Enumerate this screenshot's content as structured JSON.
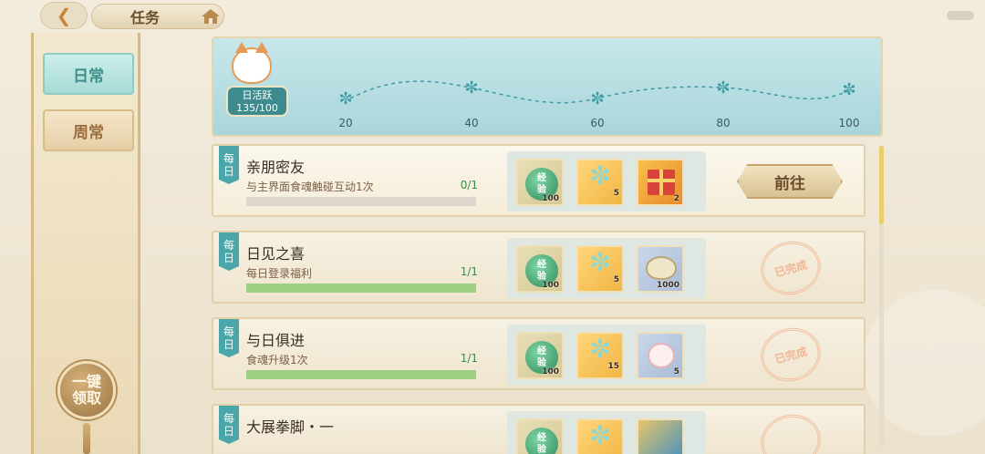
{
  "header": {
    "title": "任务",
    "back_icon": "back-arrow-icon",
    "home_icon": "house-icon"
  },
  "sidebar": {
    "tabs": [
      {
        "label": "日常",
        "active": true
      },
      {
        "label": "周常",
        "active": false
      }
    ],
    "claim_all": {
      "line1": "一键",
      "line2": "领取"
    }
  },
  "activity": {
    "label": "日活跃",
    "progress": "135/100",
    "milestones": [
      "20",
      "40",
      "60",
      "80",
      "100"
    ],
    "colors": {
      "accent": "#3d8b8e"
    }
  },
  "tasks": [
    {
      "tag": [
        "每",
        "日"
      ],
      "name": "亲朋密友",
      "desc": "与主界面食魂触碰互动1次",
      "progress_text": "0/1",
      "progress_fraction": 0,
      "rewards": [
        {
          "type": "exp",
          "icon": "exp-orb-icon",
          "label": [
            "经",
            "验"
          ],
          "count": "100"
        },
        {
          "type": "paw",
          "icon": "paw-icon",
          "count": "5"
        },
        {
          "type": "gift",
          "icon": "gift-icon",
          "count": "2"
        }
      ],
      "action": {
        "type": "go",
        "label": "前往"
      }
    },
    {
      "tag": [
        "每",
        "日"
      ],
      "name": "日见之喜",
      "desc": "每日登录福利",
      "progress_text": "1/1",
      "progress_fraction": 1,
      "rewards": [
        {
          "type": "exp",
          "icon": "exp-orb-icon",
          "label": [
            "经",
            "验"
          ],
          "count": "100"
        },
        {
          "type": "paw",
          "icon": "paw-icon",
          "count": "5"
        },
        {
          "type": "shell",
          "icon": "shell-icon",
          "count": "1000"
        }
      ],
      "action": {
        "type": "done",
        "label": "已完成"
      }
    },
    {
      "tag": [
        "每",
        "日"
      ],
      "name": "与日俱进",
      "desc": "食魂升级1次",
      "progress_text": "1/1",
      "progress_fraction": 1,
      "rewards": [
        {
          "type": "exp",
          "icon": "exp-orb-icon",
          "label": [
            "经",
            "验"
          ],
          "count": "100"
        },
        {
          "type": "paw",
          "icon": "paw-icon",
          "count": "15"
        },
        {
          "type": "bunny",
          "icon": "bunny-icon",
          "count": "5"
        }
      ],
      "action": {
        "type": "done",
        "label": "已完成"
      }
    },
    {
      "tag": [
        "每",
        "日"
      ],
      "name": "大展拳脚・一",
      "desc": "",
      "progress_text": "",
      "progress_fraction": 0,
      "rewards": [
        {
          "type": "exp",
          "icon": "exp-orb-icon",
          "label": [
            "经",
            "验"
          ],
          "count": ""
        },
        {
          "type": "paw",
          "icon": "paw-icon",
          "count": ""
        },
        {
          "type": "shell",
          "icon": "ticket-icon",
          "count": ""
        }
      ],
      "action": {
        "type": "done",
        "label": ""
      }
    }
  ]
}
